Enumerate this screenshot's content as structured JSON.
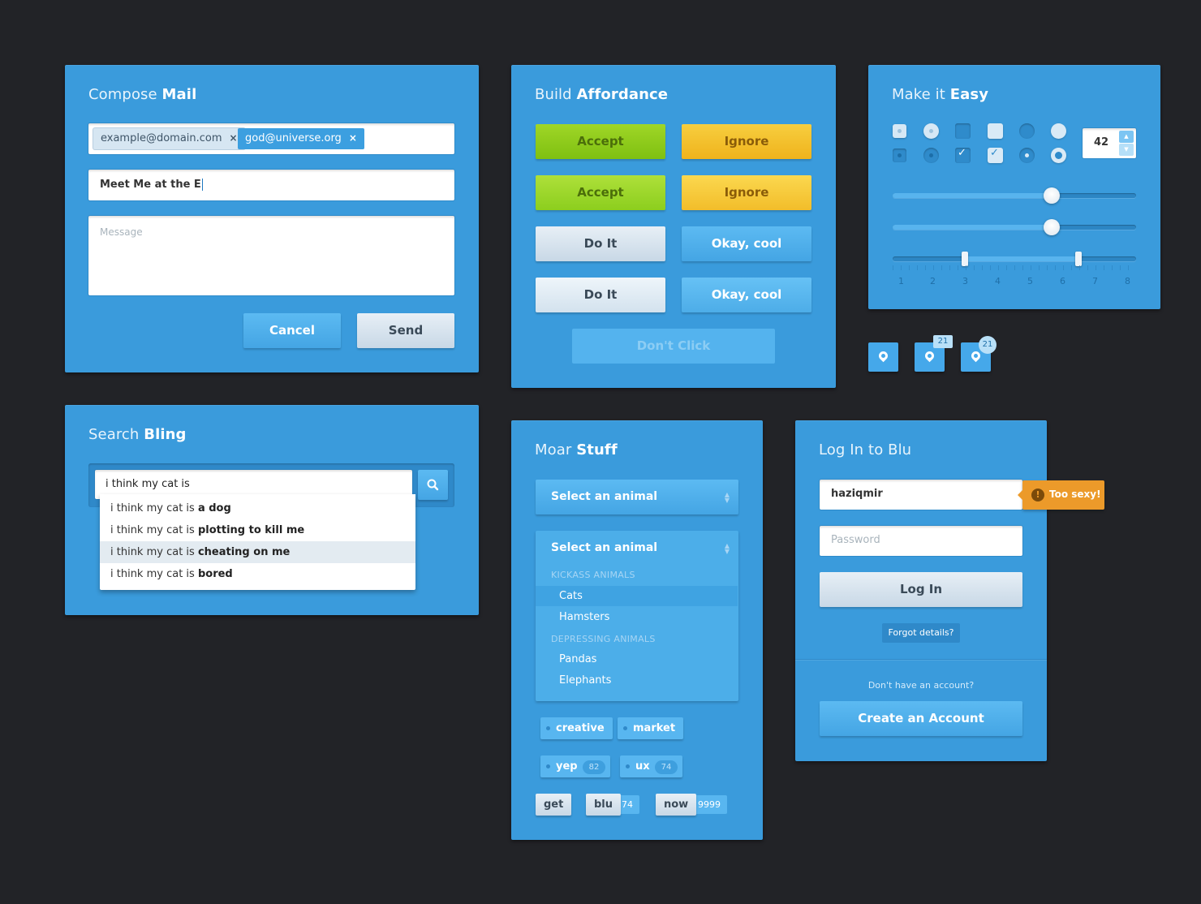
{
  "compose": {
    "title_light": "Compose",
    "title_bold": "Mail",
    "recipients": [
      {
        "email": "example@domain.com",
        "remove": "×"
      },
      {
        "email": "god@universe.org",
        "remove": "×"
      }
    ],
    "subject_value": "Meet Me at the E",
    "message_placeholder": "Message",
    "cancel_label": "Cancel",
    "send_label": "Send"
  },
  "affordance": {
    "title_light": "Build",
    "title_bold": "Affordance",
    "accept_label": "Accept",
    "ignore_label": "Ignore",
    "doit_label": "Do It",
    "okay_label": "Okay, cool",
    "dont_click_label": "Don't Click"
  },
  "easy": {
    "title_light": "Make it",
    "title_bold": "Easy",
    "stepper_value": "42",
    "slider1_level": 0.68,
    "slider2_level": 0.68,
    "range_low": 3,
    "range_high": 7,
    "scale_ticks": [
      "1",
      "2",
      "3",
      "4",
      "5",
      "6",
      "7",
      "8"
    ]
  },
  "pins": [
    {
      "badge": ""
    },
    {
      "badge": "21"
    },
    {
      "badge": "21"
    }
  ],
  "search": {
    "title_light": "Search",
    "title_bold": "Bling",
    "query": "i think my cat is",
    "suggestions": [
      {
        "prefix": "i think my cat is ",
        "completion": "a dog"
      },
      {
        "prefix": "i think my cat is ",
        "completion": "plotting to kill me"
      },
      {
        "prefix": "i think my cat is ",
        "completion": "cheating on me"
      },
      {
        "prefix": "i think my cat is ",
        "completion": "bored"
      }
    ]
  },
  "moar": {
    "title_light": "Moar",
    "title_bold": "Stuff",
    "select_label": "Select an animal",
    "dropdown_label": "Select an animal",
    "group1": "KICKASS ANIMALS",
    "group1_items": [
      "Cats",
      "Hamsters"
    ],
    "group2": "DEPRESSING ANIMALS",
    "group2_items": [
      "Pandas",
      "Elephants"
    ],
    "tags_row1": [
      "creative",
      "market"
    ],
    "tags_row2": [
      {
        "label": "yep",
        "count": "82"
      },
      {
        "label": "ux",
        "count": "74"
      }
    ],
    "tags_row3": [
      {
        "label": "get",
        "count": ""
      },
      {
        "label": "blu",
        "count": "74"
      },
      {
        "label": "now",
        "count": "9999"
      }
    ]
  },
  "login": {
    "title_light": "Log In",
    "title_bold": "to Blu",
    "username_value": "haziqmir",
    "tooltip": "Too sexy!",
    "password_placeholder": "Password",
    "login_label": "Log In",
    "forgot_label": "Forgot details?",
    "no_account": "Don't have an account?",
    "create_label": "Create an Account"
  },
  "colors": {
    "background": "#222327",
    "card": "#3a9bdc",
    "accent_green": "#8bc81b",
    "accent_yellow": "#f2bd2a",
    "accent_orange": "#ec9a2a"
  }
}
